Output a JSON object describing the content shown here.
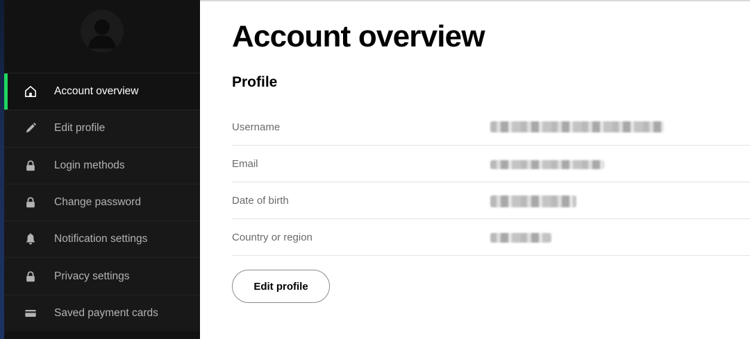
{
  "sidebar": {
    "items": [
      {
        "label": "Account overview",
        "icon": "home-icon",
        "active": true
      },
      {
        "label": "Edit profile",
        "icon": "pencil-icon",
        "active": false
      },
      {
        "label": "Login methods",
        "icon": "lock-icon",
        "active": false
      },
      {
        "label": "Change password",
        "icon": "lock-icon",
        "active": false
      },
      {
        "label": "Notification settings",
        "icon": "bell-icon",
        "active": false
      },
      {
        "label": "Privacy settings",
        "icon": "lock-icon",
        "active": false
      },
      {
        "label": "Saved payment cards",
        "icon": "card-icon",
        "active": false
      }
    ]
  },
  "main": {
    "title": "Account overview",
    "section_title": "Profile",
    "rows": [
      {
        "label": "Username",
        "value": ""
      },
      {
        "label": "Email",
        "value": ""
      },
      {
        "label": "Date of birth",
        "value": ""
      },
      {
        "label": "Country or region",
        "value": ""
      }
    ],
    "edit_button_label": "Edit profile"
  },
  "colors": {
    "sidebar_bg": "#121212",
    "active_indicator": "#1ed760",
    "text_muted": "#b3b3b3"
  }
}
